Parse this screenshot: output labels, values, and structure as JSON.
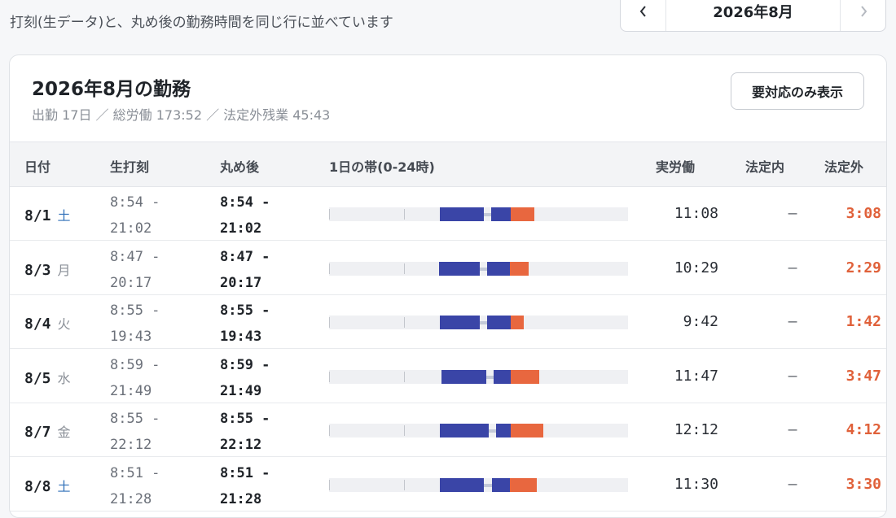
{
  "header": {
    "subtitle": "打刻(生データ)と、丸め後の勤務時間を同じ行に並べています",
    "month_label": "2026年8月",
    "prev_icon": "chevron-left-icon",
    "next_icon": "chevron-right-icon"
  },
  "card": {
    "title": "2026年8月の勤務",
    "summary": "出勤 17日 ／ 総労働 173:52 ／ 法定外残業 45:43",
    "filter_label": "要対応のみ表示"
  },
  "table": {
    "headers": {
      "date": "日付",
      "raw": "生打刻",
      "rounded": "丸め後",
      "band": "1日の帯(0-24時)",
      "actual": "実労働",
      "legal_in": "法定内",
      "legal_out": "法定外"
    },
    "rows": [
      {
        "date": "8/1",
        "weekday": "土",
        "wd_color": "#2f6fb8",
        "raw_start": "8:54 -",
        "raw_end": "21:02",
        "start": "8:54 -",
        "end": "21:02",
        "actual": "11:08",
        "legal_in": "–",
        "legal_out": "3:08",
        "band": {
          "start_h": 8.9,
          "break_start_h": 12.4,
          "break_end_h": 13.0,
          "ot_start_h": 14.6,
          "end_h": 16.5
        }
      },
      {
        "date": "8/3",
        "weekday": "月",
        "wd_color": "#8a8f97",
        "raw_start": "8:47 -",
        "raw_end": "20:17",
        "start": "8:47 -",
        "end": "20:17",
        "actual": "10:29",
        "legal_in": "–",
        "legal_out": "2:29",
        "band": {
          "start_h": 8.8,
          "break_start_h": 12.1,
          "break_end_h": 12.7,
          "ot_start_h": 14.5,
          "end_h": 16.0
        }
      },
      {
        "date": "8/4",
        "weekday": "火",
        "wd_color": "#8a8f97",
        "raw_start": "8:55 -",
        "raw_end": "19:43",
        "start": "8:55 -",
        "end": "19:43",
        "actual": "9:42",
        "legal_in": "–",
        "legal_out": "1:42",
        "band": {
          "start_h": 8.9,
          "break_start_h": 12.1,
          "break_end_h": 12.7,
          "ot_start_h": 14.6,
          "end_h": 15.6
        }
      },
      {
        "date": "8/5",
        "weekday": "水",
        "wd_color": "#8a8f97",
        "raw_start": "8:59 -",
        "raw_end": "21:49",
        "start": "8:59 -",
        "end": "21:49",
        "actual": "11:47",
        "legal_in": "–",
        "legal_out": "3:47",
        "band": {
          "start_h": 9.0,
          "break_start_h": 12.6,
          "break_end_h": 13.2,
          "ot_start_h": 14.6,
          "end_h": 16.9
        }
      },
      {
        "date": "8/7",
        "weekday": "金",
        "wd_color": "#8a8f97",
        "raw_start": "8:55 -",
        "raw_end": "22:12",
        "start": "8:55 -",
        "end": "22:12",
        "actual": "12:12",
        "legal_in": "–",
        "legal_out": "4:12",
        "band": {
          "start_h": 8.9,
          "break_start_h": 12.8,
          "break_end_h": 13.4,
          "ot_start_h": 14.6,
          "end_h": 17.2
        }
      },
      {
        "date": "8/8",
        "weekday": "土",
        "wd_color": "#2f6fb8",
        "raw_start": "8:51 -",
        "raw_end": "21:28",
        "start": "8:51 -",
        "end": "21:28",
        "actual": "11:30",
        "legal_in": "–",
        "legal_out": "3:30",
        "band": {
          "start_h": 8.9,
          "break_start_h": 12.4,
          "break_end_h": 13.1,
          "ot_start_h": 14.5,
          "end_h": 16.7
        }
      }
    ]
  },
  "colors": {
    "regular": "#3a45a7",
    "overtime": "#e8673f",
    "break": "#c3c9d8",
    "saturday": "#2f6fb8"
  }
}
